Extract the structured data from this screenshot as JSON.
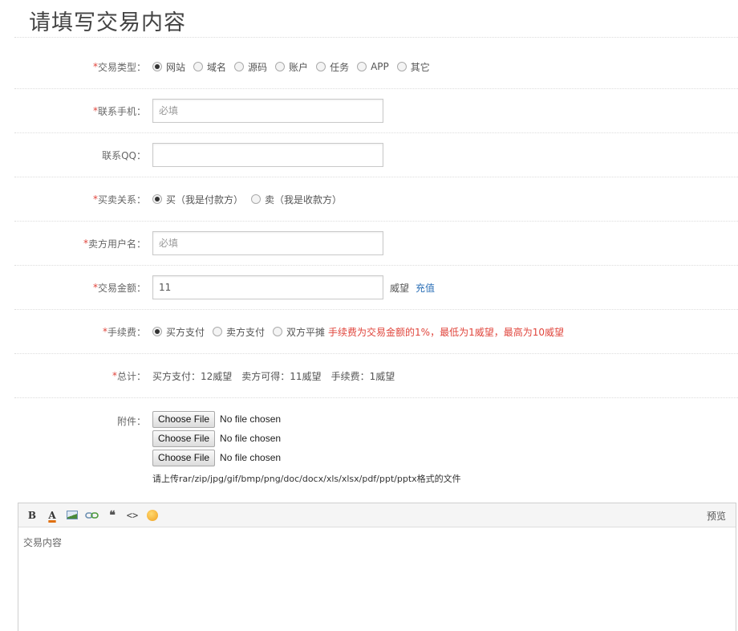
{
  "page_title": "请填写交易内容",
  "rows": {
    "trade_type": {
      "label": "交易类型：",
      "required": "*",
      "options": [
        "网站",
        "域名",
        "源码",
        "账户",
        "任务",
        "APP",
        "其它"
      ],
      "selected": 0
    },
    "phone": {
      "label": "联系手机：",
      "required": "*",
      "placeholder": "必填",
      "value": ""
    },
    "qq": {
      "label": "联系QQ：",
      "value": ""
    },
    "relation": {
      "label": "买卖关系：",
      "required": "*",
      "options": [
        "买（我是付款方）",
        "卖（我是收款方）"
      ],
      "selected": 0
    },
    "seller_username": {
      "label": "卖方用户名：",
      "required": "*",
      "placeholder": "必填",
      "value": ""
    },
    "amount": {
      "label": "交易金额：",
      "required": "*",
      "value": "11",
      "unit": "威望",
      "recharge": "充值"
    },
    "fee": {
      "label": "手续费：",
      "required": "*",
      "options": [
        "买方支付",
        "卖方支付",
        "双方平摊"
      ],
      "selected": 0,
      "note": "手续费为交易金额的1%，最低为1威望，最高为10威望"
    },
    "total": {
      "label": "总计：",
      "required": "*",
      "items": [
        "买方支付：12威望",
        "卖方可得：11威望",
        "手续费：1威望"
      ]
    }
  },
  "attachments": {
    "label": "附件：",
    "button_label": "Choose File",
    "status": "No file chosen",
    "count": 3,
    "hint": "请上传rar/zip/jpg/gif/bmp/png/doc/docx/xls/xlsx/pdf/ppt/pptx格式的文件"
  },
  "editor": {
    "toolbar": {
      "bold": "B",
      "color": "A",
      "quote": "❝",
      "code": "<>",
      "icons": [
        "bold-icon",
        "font-color-icon",
        "image-icon",
        "link-icon",
        "quote-icon",
        "code-icon",
        "emoji-icon"
      ]
    },
    "preview": "预览",
    "placeholder": "交易内容"
  },
  "colors": {
    "required": "#e0453c",
    "link": "#2b6fb6"
  }
}
